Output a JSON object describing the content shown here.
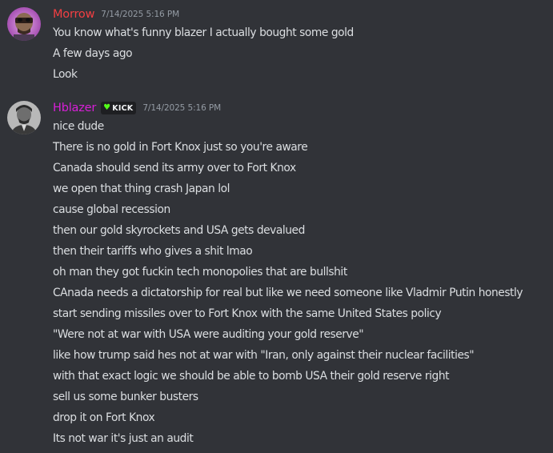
{
  "messages": [
    {
      "username": "Morrow",
      "username_color": "#f23f43",
      "timestamp": "7/14/2025 5:16 PM",
      "lines": [
        "You know what's funny blazer I actually bought some gold",
        "A few days ago",
        "Look"
      ]
    },
    {
      "username": "Hblazer",
      "username_color": "#d81fd8",
      "badge": {
        "icon": "green-heart-icon",
        "label": "KICK"
      },
      "timestamp": "7/14/2025 5:16 PM",
      "lines": [
        "nice dude",
        "There is no gold in Fort Knox just so you're aware",
        "Canada should send its army over to Fort Knox",
        "we open that thing crash Japan lol",
        "cause global recession",
        "then our gold skyrockets and USA gets devalued",
        "then their tariffs who gives a shit lmao",
        "oh man they got fuckin tech monopolies that are bullshit",
        "CAnada needs a dictatorship for real but like we need someone like Vladmir Putin honestly",
        "start sending missiles over to Fort Knox with the same United States policy",
        "\"Were not at war with USA were auditing your gold reserve\"",
        "like how trump said hes not at war with \"Iran, only against their nuclear facilities\"",
        "with that exact logic we should be able to bomb USA their gold reserve right",
        "sell us some bunker busters",
        "drop it on Fort Knox",
        "Its not war it's just an audit"
      ]
    }
  ]
}
